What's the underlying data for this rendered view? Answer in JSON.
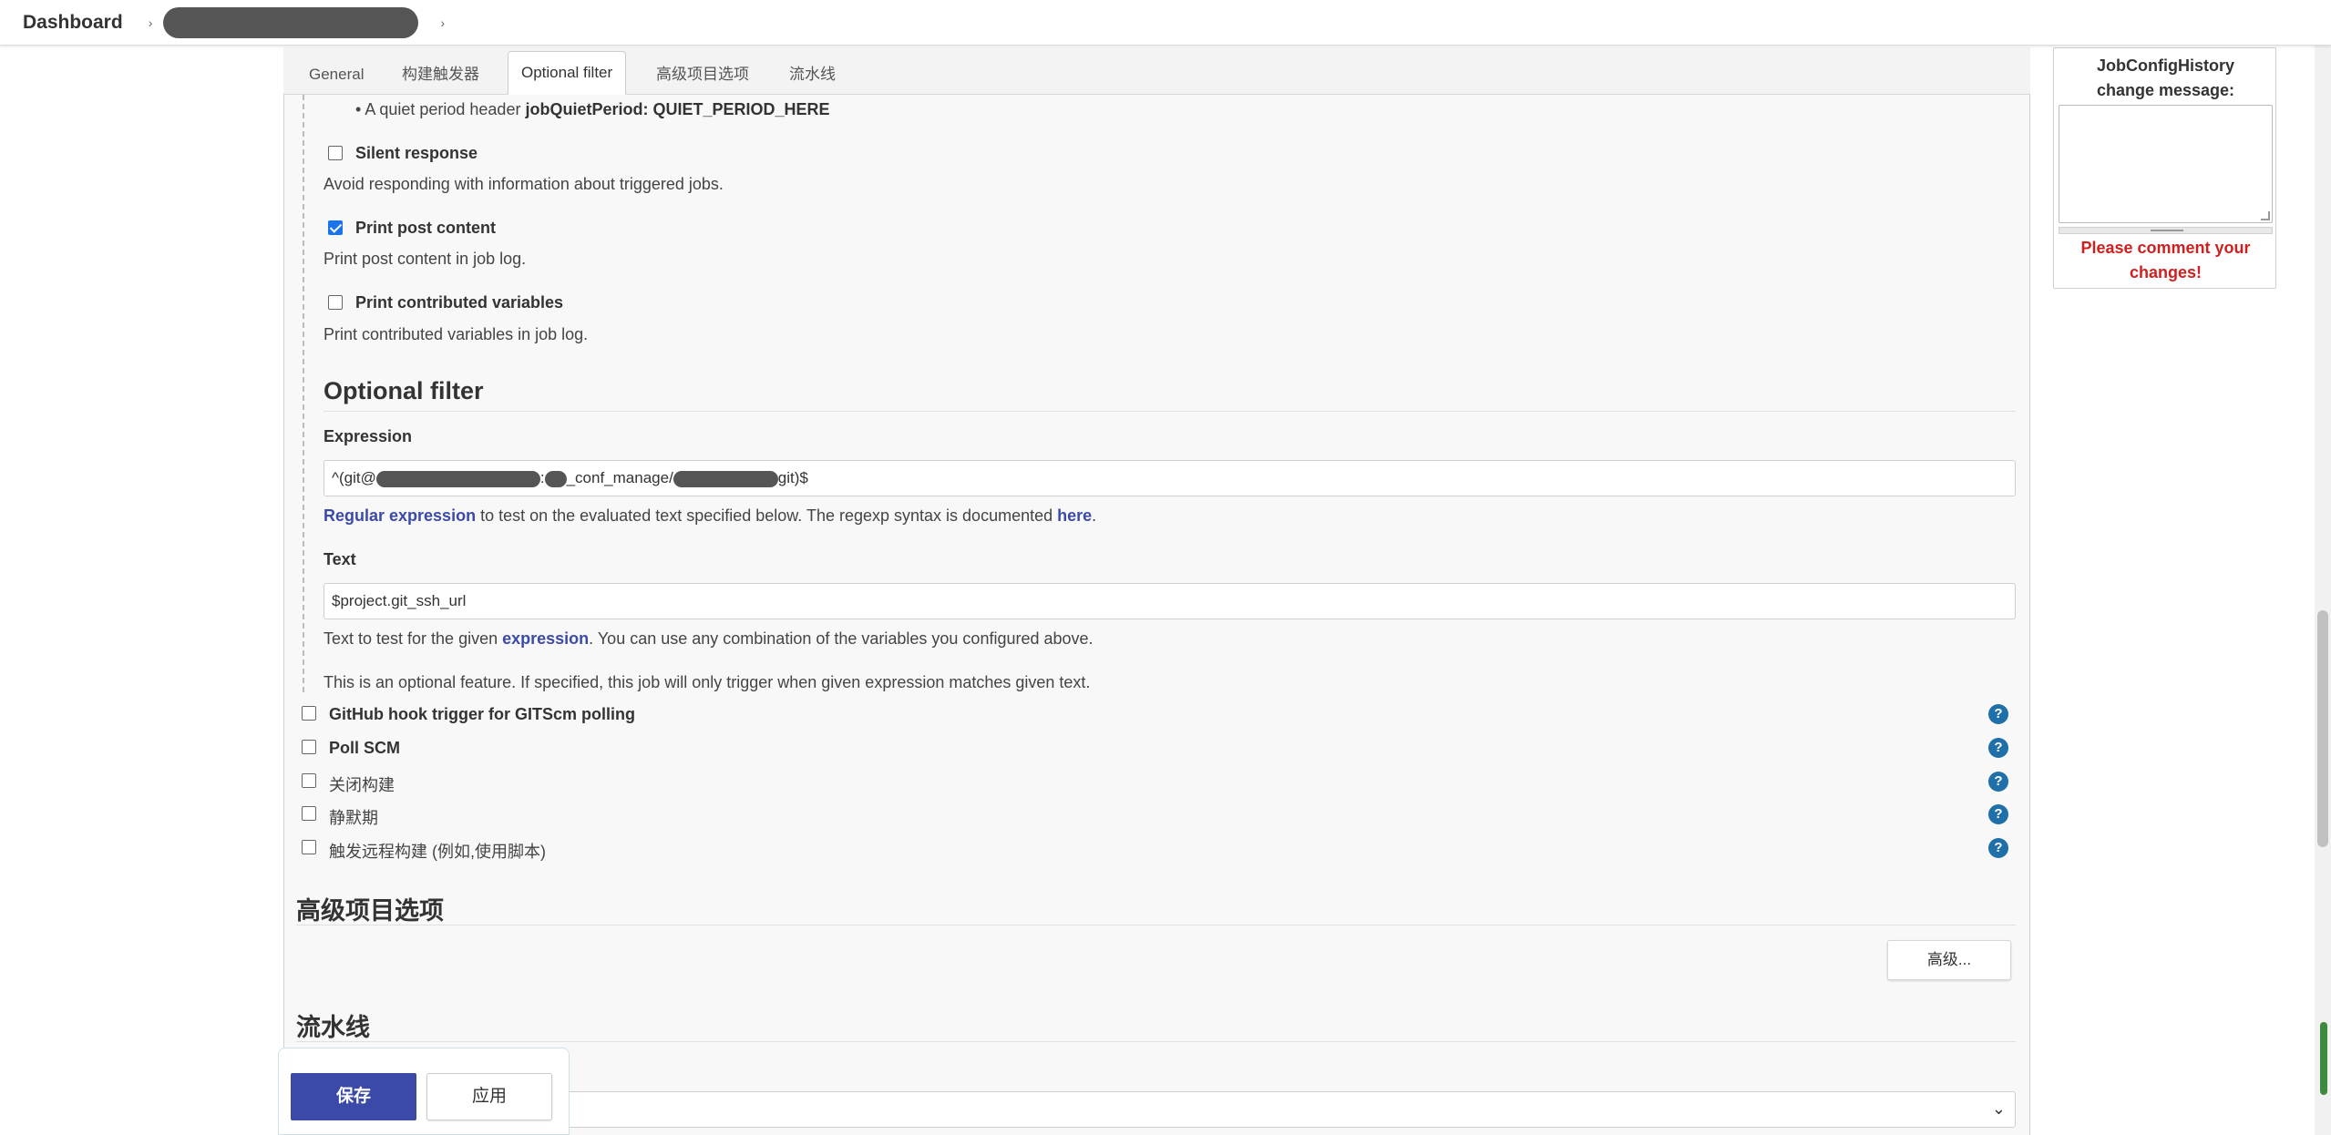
{
  "breadcrumb": {
    "home": "Dashboard",
    "separator": "›"
  },
  "tabs": [
    {
      "label": "General"
    },
    {
      "label": "构建触发器"
    },
    {
      "label": "Optional filter",
      "active": true
    },
    {
      "label": "高级项目选项"
    },
    {
      "label": "流水线"
    }
  ],
  "quiet_period": {
    "prefix": "A quiet period header",
    "header": "jobQuietPeriod: QUIET_PERIOD_HERE"
  },
  "options": [
    {
      "label": "Silent response",
      "checked": false,
      "desc": "Avoid responding with information about triggered jobs."
    },
    {
      "label": "Print post content",
      "checked": true,
      "desc": "Print post content in job log."
    },
    {
      "label": "Print contributed variables",
      "checked": false,
      "desc": "Print contributed variables in job log."
    }
  ],
  "optional_filter": {
    "title": "Optional filter",
    "expression_label": "Expression",
    "expression_value": {
      "part1": "^(git@",
      "part2": ":",
      "part3": "_conf_manage/",
      "part4": "git)$"
    },
    "expression_help": {
      "link1": "Regular expression",
      "mid": " to test on the evaluated text specified below. The regexp syntax is documented ",
      "link2": "here",
      "end": "."
    },
    "text_label": "Text",
    "text_value": "$project.git_ssh_url",
    "text_help": {
      "prefix": "Text to test for the given ",
      "link": "expression",
      "suffix": ". You can use any combination of the variables you configured above."
    },
    "note": "This is an optional feature. If specified, this job will only trigger when given expression matches given text."
  },
  "triggers": [
    {
      "label": "GitHub hook trigger for GITScm polling",
      "bold": true
    },
    {
      "label": "Poll SCM",
      "bold": true
    },
    {
      "label": "关闭构建",
      "bold": false
    },
    {
      "label": "静默期",
      "bold": false
    },
    {
      "label": "触发远程构建 (例如,使用脚本)",
      "bold": false
    }
  ],
  "help_icon": "?",
  "advanced_section": {
    "title": "高级项目选项",
    "button": "高级..."
  },
  "pipeline_section": {
    "title": "流水线",
    "select_arrow": "⌄"
  },
  "actions": {
    "save": "保存",
    "apply": "应用"
  },
  "history": {
    "title_line1": "JobConfigHistory",
    "title_line2": "change message:",
    "warning_line1": "Please comment your",
    "warning_line2": "changes!"
  },
  "colors": {
    "primary": "#3b4aa8",
    "link": "#3b4aa8",
    "warning": "#d01f1f",
    "help": "#1f6fa8",
    "checkbox_checked": "#1a73e8"
  }
}
